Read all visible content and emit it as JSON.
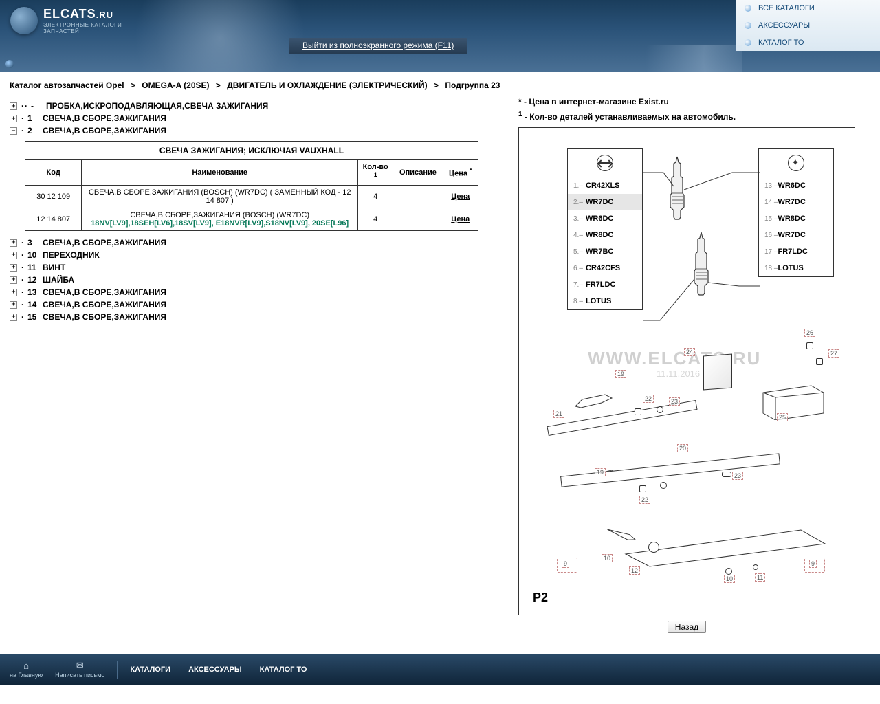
{
  "site": {
    "name": "ELCATS",
    "tld": ".RU",
    "tagline1": "ЭЛЕКТРОННЫЕ КАТАЛОГИ",
    "tagline2": "ЗАПЧАСТЕЙ"
  },
  "fullscreen_exit": "Выйти из полноэкранного режима (F11)",
  "top_nav": [
    {
      "label": "ВСЕ КАТАЛОГИ"
    },
    {
      "label": "АКСЕССУАРЫ"
    },
    {
      "label": "КАТАЛОГ ТО"
    }
  ],
  "breadcrumb": {
    "items": [
      {
        "label": "Каталог автозапчастей Opel",
        "link": true
      },
      {
        "label": "OMEGA-A (20SE)",
        "link": true
      },
      {
        "label": "ДВИГАТЕЛЬ И ОХЛАЖДЕНИЕ (ЭЛЕКТРИЧЕСКИЙ)",
        "link": true
      },
      {
        "label": "Подгруппа 23",
        "link": false
      }
    ],
    "sep": ">"
  },
  "tree": {
    "top": [
      {
        "num": "-",
        "label": "ПРОБКА,ИСКРОПОДАВЛЯЮЩАЯ,СВЕЧА ЗАЖИГАНИЯ",
        "expanded": false
      },
      {
        "num": "1",
        "label": "СВЕЧА,В СБОРЕ,ЗАЖИГАНИЯ",
        "expanded": false
      },
      {
        "num": "2",
        "label": "СВЕЧА,В СБОРЕ,ЗАЖИГАНИЯ",
        "expanded": true
      }
    ],
    "bottom": [
      {
        "num": "3",
        "label": "СВЕЧА,В СБОРЕ,ЗАЖИГАНИЯ"
      },
      {
        "num": "10",
        "label": "ПЕРЕХОДНИК"
      },
      {
        "num": "11",
        "label": "ВИНТ"
      },
      {
        "num": "12",
        "label": "ШАЙБА"
      },
      {
        "num": "13",
        "label": "СВЕЧА,В СБОРЕ,ЗАЖИГАНИЯ"
      },
      {
        "num": "14",
        "label": "СВЕЧА,В СБОРЕ,ЗАЖИГАНИЯ"
      },
      {
        "num": "15",
        "label": "СВЕЧА,В СБОРЕ,ЗАЖИГАНИЯ"
      }
    ]
  },
  "table": {
    "title": "СВЕЧА ЗАЖИГАНИЯ; ИСКЛЮЧАЯ VAUXHALL",
    "headers": {
      "code": "Код",
      "name": "Наименование",
      "qty": "Кол-во",
      "qty_sup": "1",
      "desc": "Описание",
      "price": "Цена",
      "price_sup": "*"
    },
    "rows": [
      {
        "code": "30 12 109",
        "name": "СВЕЧА,В СБОРЕ,ЗАЖИГАНИЯ (BOSCH) (WR7DC) ( ЗАМЕННЫЙ КОД - 12 14 807 )",
        "sub": "",
        "qty": "4",
        "desc": "",
        "price": "Цена"
      },
      {
        "code": "12 14 807",
        "name": "СВЕЧА,В СБОРЕ,ЗАЖИГАНИЯ (BOSCH) (WR7DC)",
        "sub": "18NV[LV9],18SEH[LV6],18SV[LV9], E18NVR[LV9],S18NV[LV9], 20SE[L96]",
        "qty": "4",
        "desc": "",
        "price": "Цена"
      }
    ]
  },
  "legend": {
    "price": "* - Цена в интернет-магазине Exist.ru",
    "qty_key": "1",
    "qty": " - Кол-во деталей устанавливаемых на автомобиль."
  },
  "diagram": {
    "watermark": "WWW.ELCATS.RU",
    "wm_date": "11.11.2016",
    "plate": "P2",
    "left_box": [
      {
        "n": "1",
        "l": "CR42XLS"
      },
      {
        "n": "2",
        "l": "WR7DC",
        "sel": true
      },
      {
        "n": "3",
        "l": "WR6DC"
      },
      {
        "n": "4",
        "l": "WR8DC"
      },
      {
        "n": "5",
        "l": "WR7BC"
      },
      {
        "n": "6",
        "l": "CR42CFS"
      },
      {
        "n": "7",
        "l": "FR7LDC"
      },
      {
        "n": "8",
        "l": "LOTUS"
      }
    ],
    "right_box": [
      {
        "n": "13",
        "l": "WR6DC"
      },
      {
        "n": "14",
        "l": "WR7DC"
      },
      {
        "n": "15",
        "l": "WR8DC"
      },
      {
        "n": "16",
        "l": "WR7DC"
      },
      {
        "n": "17",
        "l": "FR7LDC"
      },
      {
        "n": "18",
        "l": "LOTUS"
      }
    ],
    "callouts": [
      "9",
      "10",
      "11",
      "12",
      "19",
      "20",
      "21",
      "22",
      "23",
      "24",
      "25",
      "26",
      "27"
    ]
  },
  "back_button": "Назад",
  "footer": {
    "icons": [
      {
        "label": "на Главную",
        "glyph": "⌂"
      },
      {
        "label": "Написать письмо",
        "glyph": "✉"
      }
    ],
    "links": [
      "КАТАЛОГИ",
      "АКСЕССУАРЫ",
      "КАТАЛОГ ТО"
    ]
  }
}
